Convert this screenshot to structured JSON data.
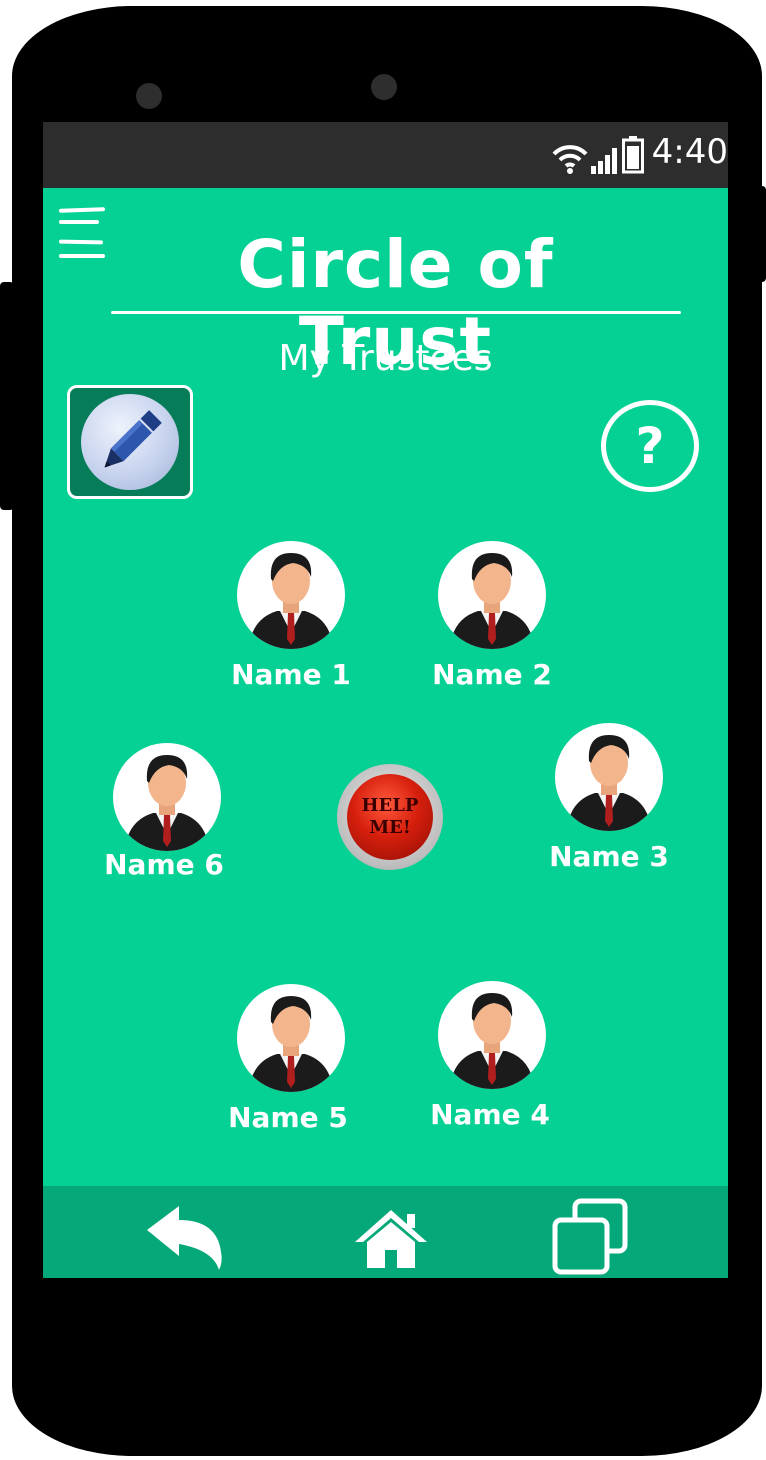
{
  "status_bar": {
    "time": "4:40",
    "wifi_icon": "wifi-icon",
    "signal_icon": "signal-icon",
    "battery_icon": "battery-icon"
  },
  "header": {
    "title": "Circle of Trust",
    "subtitle": "My Trustees",
    "menu_icon": "hamburger-menu-icon"
  },
  "toolbar": {
    "edit_icon": "pencil-icon",
    "help_icon": "question-icon",
    "help_symbol": "?"
  },
  "trustees": [
    {
      "name": "Name 1"
    },
    {
      "name": "Name 2"
    },
    {
      "name": "Name 3"
    },
    {
      "name": "Name 4"
    },
    {
      "name": "Name 5"
    },
    {
      "name": "Name 6"
    }
  ],
  "help_button": {
    "line1": "HELP",
    "line2": "ME!"
  },
  "nav": {
    "back_icon": "back-arrow-icon",
    "home_icon": "home-icon",
    "recents_icon": "recent-apps-icon"
  },
  "colors": {
    "screen": "#05d195",
    "nav_bar": "#05a878",
    "status_bar": "#2d2d2d",
    "edit_button": "#067c58"
  }
}
